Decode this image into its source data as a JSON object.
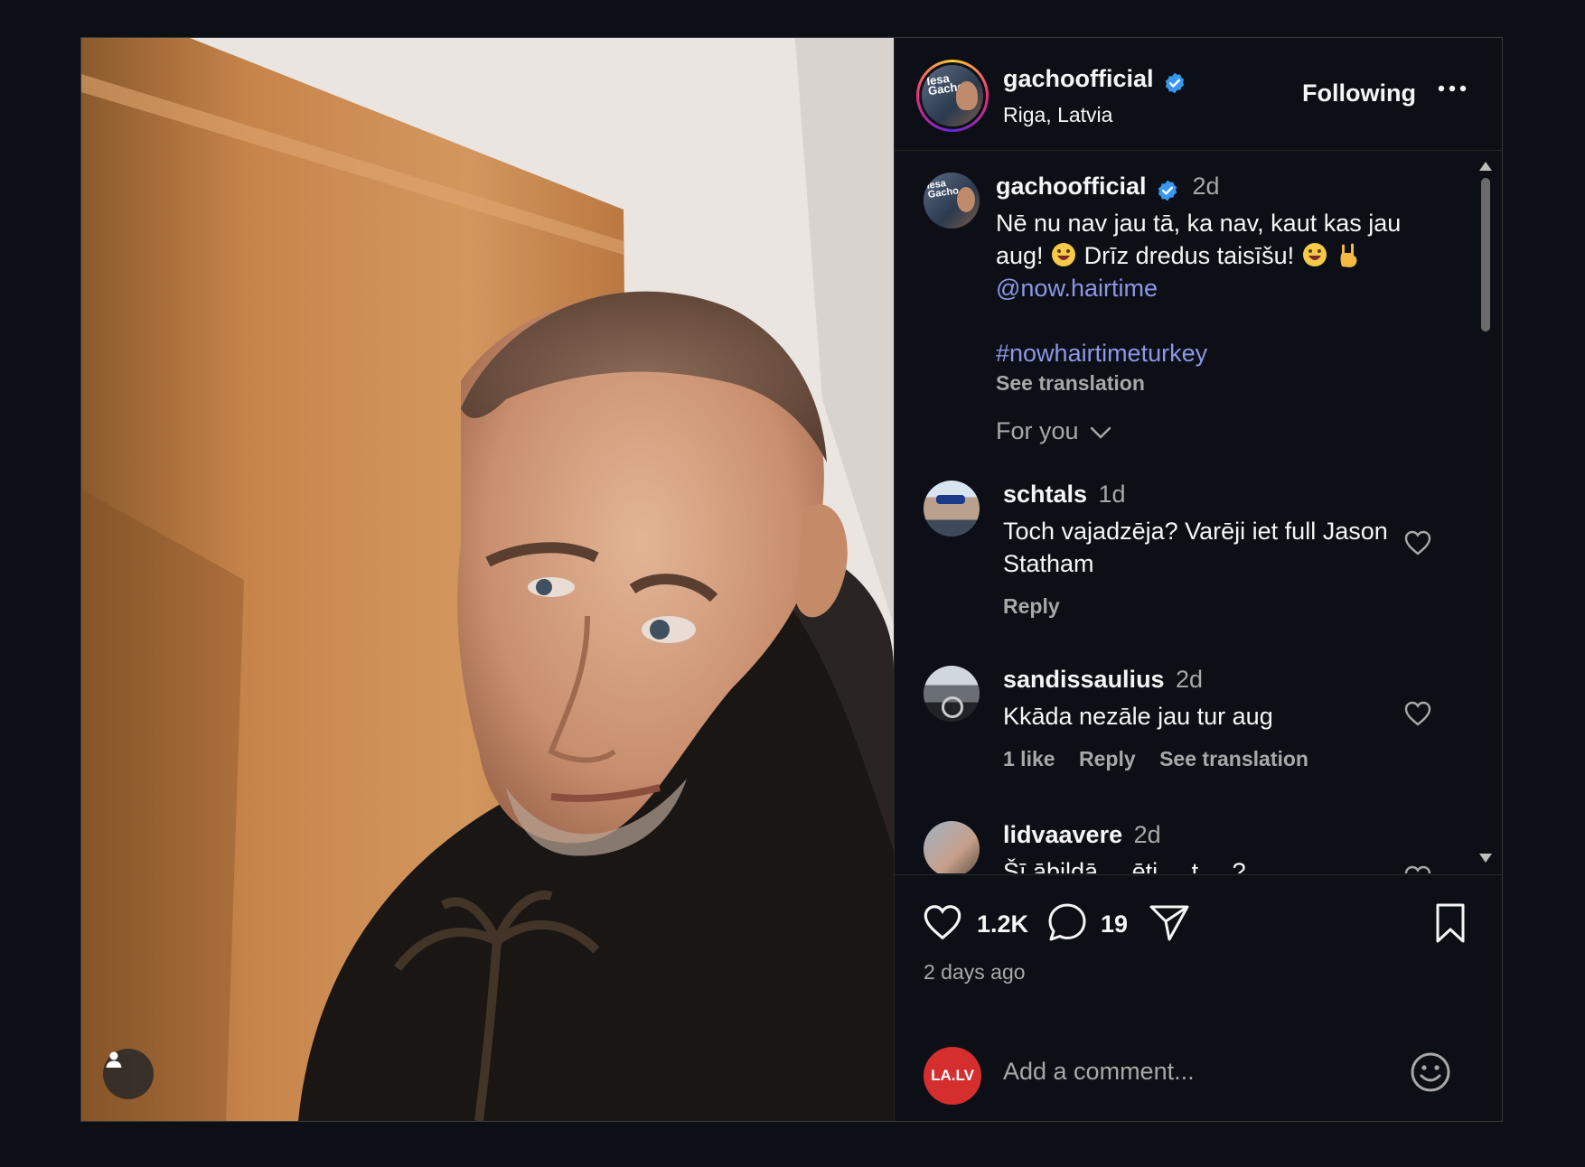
{
  "post": {
    "author": "gachoofficial",
    "location": "Riga, Latvia",
    "follow_state": "Following",
    "avatar_text": "Iesa Gacho"
  },
  "caption": {
    "username": "gachoofficial",
    "time": "2d",
    "text_part1": "Nē nu nav jau tā, ka nav, kaut kas jau aug!",
    "text_part2": "Drīz dredus taisīšu!",
    "mention": "@now.hairtime",
    "hashtag": "#nowhairtimeturkey",
    "see_translation": "See translation"
  },
  "sort": {
    "label": "For you"
  },
  "comments": [
    {
      "username": "schtals",
      "time": "1d",
      "text": "Toch vajadzēja? Varēji iet full Jason Statham",
      "actions": [
        "Reply"
      ]
    },
    {
      "username": "sandissaulius",
      "time": "2d",
      "text": "Kkāda nezāle jau tur aug",
      "actions": [
        "1 like",
        "Reply",
        "See translation"
      ]
    },
    {
      "username": "lidvaavere",
      "time": "2d",
      "text": "Šī ābildā ... ēti ... t ... ?"
    }
  ],
  "stats": {
    "likes": "1.2K",
    "comments": "19",
    "posted": "2 days ago"
  },
  "composer": {
    "placeholder": "Add a comment...",
    "avatar_label": "LA.LV"
  },
  "icons": {
    "verified": "verified-badge-icon",
    "more": "more-options-icon",
    "like": "heart-icon",
    "comment": "comment-icon",
    "share": "share-icon",
    "save": "bookmark-icon",
    "emoji": "smiley-icon",
    "user_tag": "user-icon",
    "chevron": "chevron-down-icon"
  },
  "colors": {
    "accent_link": "#8e96e6",
    "verified": "#3897f0",
    "muted": "#a8a8a8",
    "background": "#0c1016"
  }
}
